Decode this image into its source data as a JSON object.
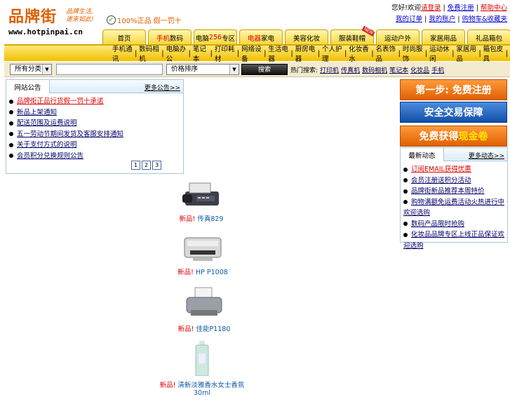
{
  "logo": {
    "name": "品牌街",
    "slogan_line1": "品牌生活,",
    "slogan_line2": "遂来如此!",
    "url": "www.hotpinpai.cn"
  },
  "guarantee": "100%正品 假一罚十",
  "toplinks": {
    "row1": {
      "prefix": "您好!欢迎",
      "login": "请登录",
      "register": "免费注册",
      "help": "帮助中心"
    },
    "row2": [
      "我的订单",
      "我的账户",
      "购物车&收藏夹"
    ]
  },
  "nav": [
    {
      "label": "首页"
    },
    {
      "label": "数码",
      "pre": "",
      "hl": "手机"
    },
    {
      "label": "专区",
      "hl": "256",
      "pre": "电脑"
    },
    {
      "label": "家电",
      "hl": "电器"
    },
    {
      "label": "美容化妆"
    },
    {
      "label": "服装鞋帽",
      "badge": "NEW"
    },
    {
      "label": "运动户外"
    },
    {
      "label": "家居用品"
    },
    {
      "label": "礼品箱包"
    }
  ],
  "categories": [
    "手机通讯",
    "数码相机",
    "电脑办公",
    "笔记本",
    "打印耗材",
    "网络设备",
    "生活电器",
    "厨房电器",
    "个人护理",
    "化妆香水",
    "名表饰品",
    "时尚服饰",
    "运动休闲",
    "家居用品",
    "箱包皮具"
  ],
  "search": {
    "category": "所有分类",
    "placeholder": "",
    "sort": "价格排序",
    "button": "搜索",
    "hot_label": "热门搜索:",
    "hot": [
      "打印机",
      "传真机",
      "数码相机",
      "笔记本",
      "化妆品",
      "手机"
    ]
  },
  "notice": {
    "title": "网站公告",
    "more": "更多公告>>",
    "items": [
      {
        "text": "品牌街正品行货假一罚十承诺",
        "red": true
      },
      {
        "text": "新品上架通知"
      },
      {
        "text": "配送范围及运费说明"
      },
      {
        "text": "五一劳动节期间发货及客服安排通知"
      },
      {
        "text": "关于支付方式的说明"
      },
      {
        "text": "会员积分兑换规则公告"
      }
    ],
    "pages": [
      "1",
      "2",
      "3"
    ]
  },
  "products": [
    {
      "new": "新品!",
      "name": "传真829"
    },
    {
      "new": "新品!",
      "name": "HP P1008"
    },
    {
      "new": "新品!",
      "name": "佳能P1180"
    },
    {
      "new": "新品!",
      "name": "清新淡雅香水女士香氛 30ml"
    }
  ],
  "banners": {
    "register": "第一步: 免费注册",
    "safe": "安全交易保障",
    "coupon_a": "免费获得",
    "coupon_b": "现金卷"
  },
  "news": {
    "title": "最新动态",
    "more": "更多动态>>",
    "items": [
      {
        "text": "订阅EMAIL获得优惠",
        "red": true
      },
      {
        "text": "会员注册送积分活动"
      },
      {
        "text": "品牌街新品推荐本周特价"
      },
      {
        "text": "购物满额免运费活动火热进行中欢迎选购"
      },
      {
        "text": "数码产品限时抢购"
      },
      {
        "text": "化妆品品牌专区上线正品保证欢迎选购"
      }
    ]
  },
  "colors": {
    "accent": "#e06000",
    "nav_yellow": "#f5d63a",
    "link_blue": "#0000cc",
    "banner_blue": "#1250a8"
  }
}
